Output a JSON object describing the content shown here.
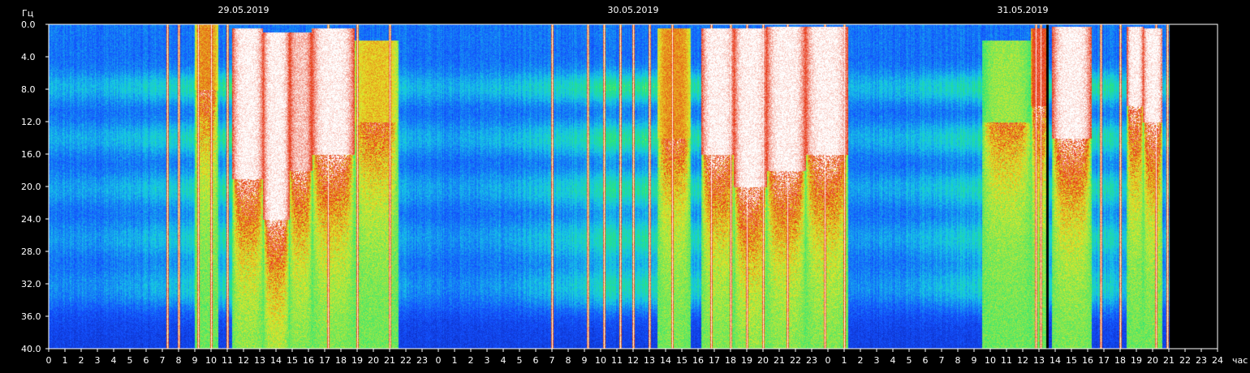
{
  "chart_data": {
    "type": "heatmap",
    "title": "",
    "ylabel": "Гц",
    "xlabel": "час",
    "ylim": [
      0,
      40
    ],
    "y_ticks": [
      "0.0",
      "4.0",
      "8.0",
      "12.0",
      "16.0",
      "20.0",
      "24.0",
      "28.0",
      "32.0",
      "36.0",
      "40.0"
    ],
    "x_hours_total": 72,
    "x_ticks": [
      "0",
      "1",
      "2",
      "3",
      "4",
      "5",
      "6",
      "7",
      "8",
      "9",
      "10",
      "11",
      "12",
      "13",
      "14",
      "15",
      "16",
      "17",
      "18",
      "19",
      "20",
      "21",
      "22",
      "23",
      "0",
      "1",
      "2",
      "3",
      "4",
      "5",
      "6",
      "7",
      "8",
      "9",
      "10",
      "11",
      "12",
      "13",
      "14",
      "15",
      "16",
      "17",
      "18",
      "19",
      "20",
      "21",
      "22",
      "23",
      "0",
      "1",
      "2",
      "3",
      "4",
      "5",
      "6",
      "7",
      "8",
      "9",
      "10",
      "11",
      "12",
      "13",
      "14",
      "15",
      "16",
      "17",
      "18",
      "19",
      "20",
      "21",
      "22",
      "23",
      "24"
    ],
    "dates": [
      {
        "label": "29.05.2019",
        "hour": 12
      },
      {
        "label": "30.05.2019",
        "hour": 36
      },
      {
        "label": "31.05.2019",
        "hour": 60
      }
    ],
    "data_end_hour": 69,
    "gap_hour": 61.5,
    "resonance_bands_hz": [
      7.8,
      14.1,
      20.3,
      26.4,
      32.4
    ],
    "colorscale": [
      "#0a1ea0",
      "#1450ff",
      "#16c8e6",
      "#28e678",
      "#e6e628",
      "#e63214",
      "#ffffff"
    ],
    "bursts": [
      {
        "start": 11.3,
        "end": 13.2,
        "top_hz": 0.5,
        "bottom_hz": 19,
        "level": 1.0
      },
      {
        "start": 13.2,
        "end": 14.8,
        "top_hz": 1,
        "bottom_hz": 24,
        "level": 1.0
      },
      {
        "start": 14.8,
        "end": 16.2,
        "top_hz": 1,
        "bottom_hz": 18,
        "level": 0.95
      },
      {
        "start": 16.2,
        "end": 18.8,
        "top_hz": 0.5,
        "bottom_hz": 16,
        "level": 1.0
      },
      {
        "start": 18.8,
        "end": 21.5,
        "top_hz": 2,
        "bottom_hz": 12,
        "level": 0.7
      },
      {
        "start": 9.0,
        "end": 10.4,
        "top_hz": 0,
        "bottom_hz": 8,
        "level": 0.75
      },
      {
        "start": 37.5,
        "end": 39.5,
        "top_hz": 0.5,
        "bottom_hz": 14,
        "level": 0.75
      },
      {
        "start": 40.2,
        "end": 42.2,
        "top_hz": 0.5,
        "bottom_hz": 16,
        "level": 1.0
      },
      {
        "start": 42.2,
        "end": 44.2,
        "top_hz": 0.5,
        "bottom_hz": 20,
        "level": 1.0
      },
      {
        "start": 44.2,
        "end": 46.6,
        "top_hz": 0.3,
        "bottom_hz": 18,
        "level": 1.0
      },
      {
        "start": 46.6,
        "end": 49.2,
        "top_hz": 0.3,
        "bottom_hz": 16,
        "level": 1.0
      },
      {
        "start": 57.5,
        "end": 60.5,
        "top_hz": 2,
        "bottom_hz": 12,
        "level": 0.6
      },
      {
        "start": 60.5,
        "end": 61.5,
        "top_hz": 0.5,
        "bottom_hz": 10,
        "level": 0.85
      },
      {
        "start": 61.8,
        "end": 64.2,
        "top_hz": 0.3,
        "bottom_hz": 14,
        "level": 1.0
      },
      {
        "start": 66.4,
        "end": 67.4,
        "top_hz": 0.3,
        "bottom_hz": 10,
        "level": 1.0
      },
      {
        "start": 67.4,
        "end": 68.6,
        "top_hz": 0.5,
        "bottom_hz": 12,
        "level": 1.0
      }
    ],
    "spikes_hour": [
      7.3,
      8.0,
      9.2,
      10.0,
      11.0,
      17.2,
      19.0,
      21.0,
      31.0,
      33.2,
      34.2,
      35.2,
      36.0,
      37.0,
      38.4,
      40.8,
      42.0,
      43.0,
      44.0,
      45.5,
      47.8,
      49.0,
      60.8,
      61.1,
      64.8,
      66.0,
      68.2,
      68.9
    ]
  }
}
